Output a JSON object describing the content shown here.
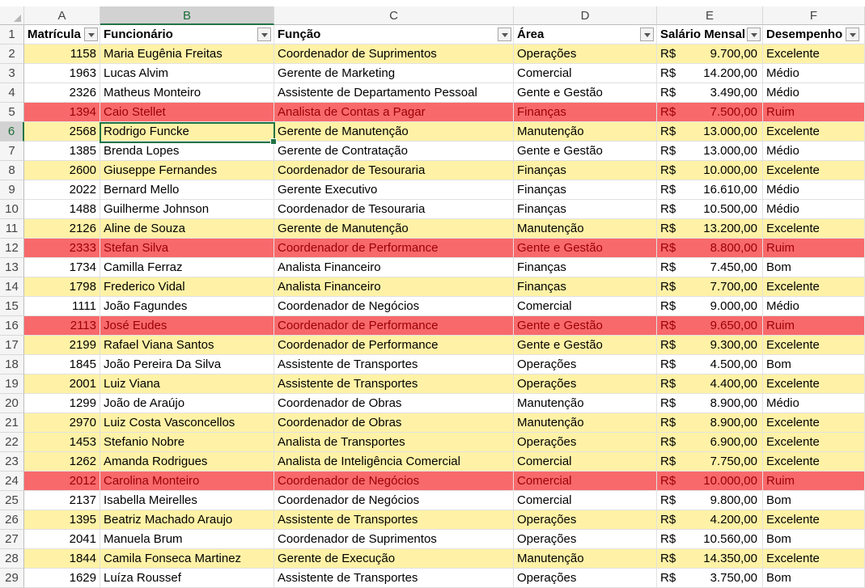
{
  "columns": [
    "A",
    "B",
    "C",
    "D",
    "E",
    "F"
  ],
  "selected_column": "B",
  "selected_row": "6",
  "headers": {
    "row_number": "1",
    "matricula": "Matrícula",
    "funcionario": "Funcionário",
    "funcao": "Função",
    "area": "Área",
    "salario": "Salário Mensal",
    "desempenho": "Desempenho"
  },
  "currency_symbol": "R$",
  "colors": {
    "excelente": "#fff2a6",
    "ruim": "#f8696b",
    "ruim_text": "#9c0006",
    "selection": "#217346"
  },
  "rows": [
    {
      "n": "2",
      "matricula": "1158",
      "funcionario": "Maria Eugênia Freitas",
      "funcao": "Coordenador de Suprimentos",
      "area": "Operações",
      "salario": "9.700,00",
      "desempenho": "Excelente"
    },
    {
      "n": "3",
      "matricula": "1963",
      "funcionario": "Lucas Alvim",
      "funcao": "Gerente de Marketing",
      "area": "Comercial",
      "salario": "14.200,00",
      "desempenho": "Médio"
    },
    {
      "n": "4",
      "matricula": "2326",
      "funcionario": "Matheus Monteiro",
      "funcao": "Assistente de Departamento Pessoal",
      "area": "Gente e Gestão",
      "salario": "3.490,00",
      "desempenho": "Médio"
    },
    {
      "n": "5",
      "matricula": "1394",
      "funcionario": "Caio Stellet",
      "funcao": "Analista de Contas a Pagar",
      "area": "Finanças",
      "salario": "7.500,00",
      "desempenho": "Ruim"
    },
    {
      "n": "6",
      "matricula": "2568",
      "funcionario": "Rodrigo Funcke",
      "funcao": "Gerente de Manutenção",
      "area": "Manutenção",
      "salario": "13.000,00",
      "desempenho": "Excelente"
    },
    {
      "n": "7",
      "matricula": "1385",
      "funcionario": "Brenda Lopes",
      "funcao": "Gerente de Contratação",
      "area": "Gente e Gestão",
      "salario": "13.000,00",
      "desempenho": "Médio"
    },
    {
      "n": "8",
      "matricula": "2600",
      "funcionario": "Giuseppe Fernandes",
      "funcao": "Coordenador de Tesouraria",
      "area": "Finanças",
      "salario": "10.000,00",
      "desempenho": "Excelente"
    },
    {
      "n": "9",
      "matricula": "2022",
      "funcionario": "Bernard Mello",
      "funcao": "Gerente Executivo",
      "area": "Finanças",
      "salario": "16.610,00",
      "desempenho": "Médio"
    },
    {
      "n": "10",
      "matricula": "1488",
      "funcionario": "Guilherme Johnson",
      "funcao": "Coordenador de Tesouraria",
      "area": "Finanças",
      "salario": "10.500,00",
      "desempenho": "Médio"
    },
    {
      "n": "11",
      "matricula": "2126",
      "funcionario": "Aline de Souza",
      "funcao": "Gerente de Manutenção",
      "area": "Manutenção",
      "salario": "13.200,00",
      "desempenho": "Excelente"
    },
    {
      "n": "12",
      "matricula": "2333",
      "funcionario": "Stefan Silva",
      "funcao": "Coordenador de Performance",
      "area": "Gente e Gestão",
      "salario": "8.800,00",
      "desempenho": "Ruim"
    },
    {
      "n": "13",
      "matricula": "1734",
      "funcionario": "Camilla Ferraz",
      "funcao": "Analista Financeiro",
      "area": "Finanças",
      "salario": "7.450,00",
      "desempenho": "Bom"
    },
    {
      "n": "14",
      "matricula": "1798",
      "funcionario": "Frederico Vidal",
      "funcao": "Analista Financeiro",
      "area": "Finanças",
      "salario": "7.700,00",
      "desempenho": "Excelente"
    },
    {
      "n": "15",
      "matricula": "1111",
      "funcionario": "João Fagundes",
      "funcao": "Coordenador de Negócios",
      "area": "Comercial",
      "salario": "9.000,00",
      "desempenho": "Médio"
    },
    {
      "n": "16",
      "matricula": "2113",
      "funcionario": "José Eudes",
      "funcao": "Coordenador de Performance",
      "area": "Gente e Gestão",
      "salario": "9.650,00",
      "desempenho": "Ruim"
    },
    {
      "n": "17",
      "matricula": "2199",
      "funcionario": "Rafael Viana Santos",
      "funcao": "Coordenador de Performance",
      "area": "Gente e Gestão",
      "salario": "9.300,00",
      "desempenho": "Excelente"
    },
    {
      "n": "18",
      "matricula": "1845",
      "funcionario": "João Pereira Da Silva",
      "funcao": "Assistente de Transportes",
      "area": "Operações",
      "salario": "4.500,00",
      "desempenho": "Bom"
    },
    {
      "n": "19",
      "matricula": "2001",
      "funcionario": "Luiz Viana",
      "funcao": "Assistente de Transportes",
      "area": "Operações",
      "salario": "4.400,00",
      "desempenho": "Excelente"
    },
    {
      "n": "20",
      "matricula": "1299",
      "funcionario": "João de Araújo",
      "funcao": "Coordenador de Obras",
      "area": "Manutenção",
      "salario": "8.900,00",
      "desempenho": "Médio"
    },
    {
      "n": "21",
      "matricula": "2970",
      "funcionario": "Luiz Costa Vasconcellos",
      "funcao": "Coordenador de Obras",
      "area": "Manutenção",
      "salario": "8.900,00",
      "desempenho": "Excelente"
    },
    {
      "n": "22",
      "matricula": "1453",
      "funcionario": "Stefanio Nobre",
      "funcao": "Analista de Transportes",
      "area": "Operações",
      "salario": "6.900,00",
      "desempenho": "Excelente"
    },
    {
      "n": "23",
      "matricula": "1262",
      "funcionario": "Amanda Rodrigues",
      "funcao": "Analista de Inteligência Comercial",
      "area": "Comercial",
      "salario": "7.750,00",
      "desempenho": "Excelente"
    },
    {
      "n": "24",
      "matricula": "2012",
      "funcionario": "Carolina Monteiro",
      "funcao": "Coordenador de Negócios",
      "area": "Comercial",
      "salario": "10.000,00",
      "desempenho": "Ruim"
    },
    {
      "n": "25",
      "matricula": "2137",
      "funcionario": "Isabella Meirelles",
      "funcao": "Coordenador de Negócios",
      "area": "Comercial",
      "salario": "9.800,00",
      "desempenho": "Bom"
    },
    {
      "n": "26",
      "matricula": "1395",
      "funcionario": "Beatriz Machado Araujo",
      "funcao": "Assistente de Transportes",
      "area": "Operações",
      "salario": "4.200,00",
      "desempenho": "Excelente"
    },
    {
      "n": "27",
      "matricula": "2041",
      "funcionario": "Manuela Brum",
      "funcao": "Coordenador de Suprimentos",
      "area": "Operações",
      "salario": "10.560,00",
      "desempenho": "Bom"
    },
    {
      "n": "28",
      "matricula": "1844",
      "funcionario": "Camila Fonseca Martinez",
      "funcao": "Gerente de Execução",
      "area": "Manutenção",
      "salario": "14.350,00",
      "desempenho": "Excelente"
    },
    {
      "n": "29",
      "matricula": "1629",
      "funcionario": "Luíza Roussef",
      "funcao": "Assistente de Transportes",
      "area": "Operações",
      "salario": "3.750,00",
      "desempenho": "Bom"
    }
  ]
}
